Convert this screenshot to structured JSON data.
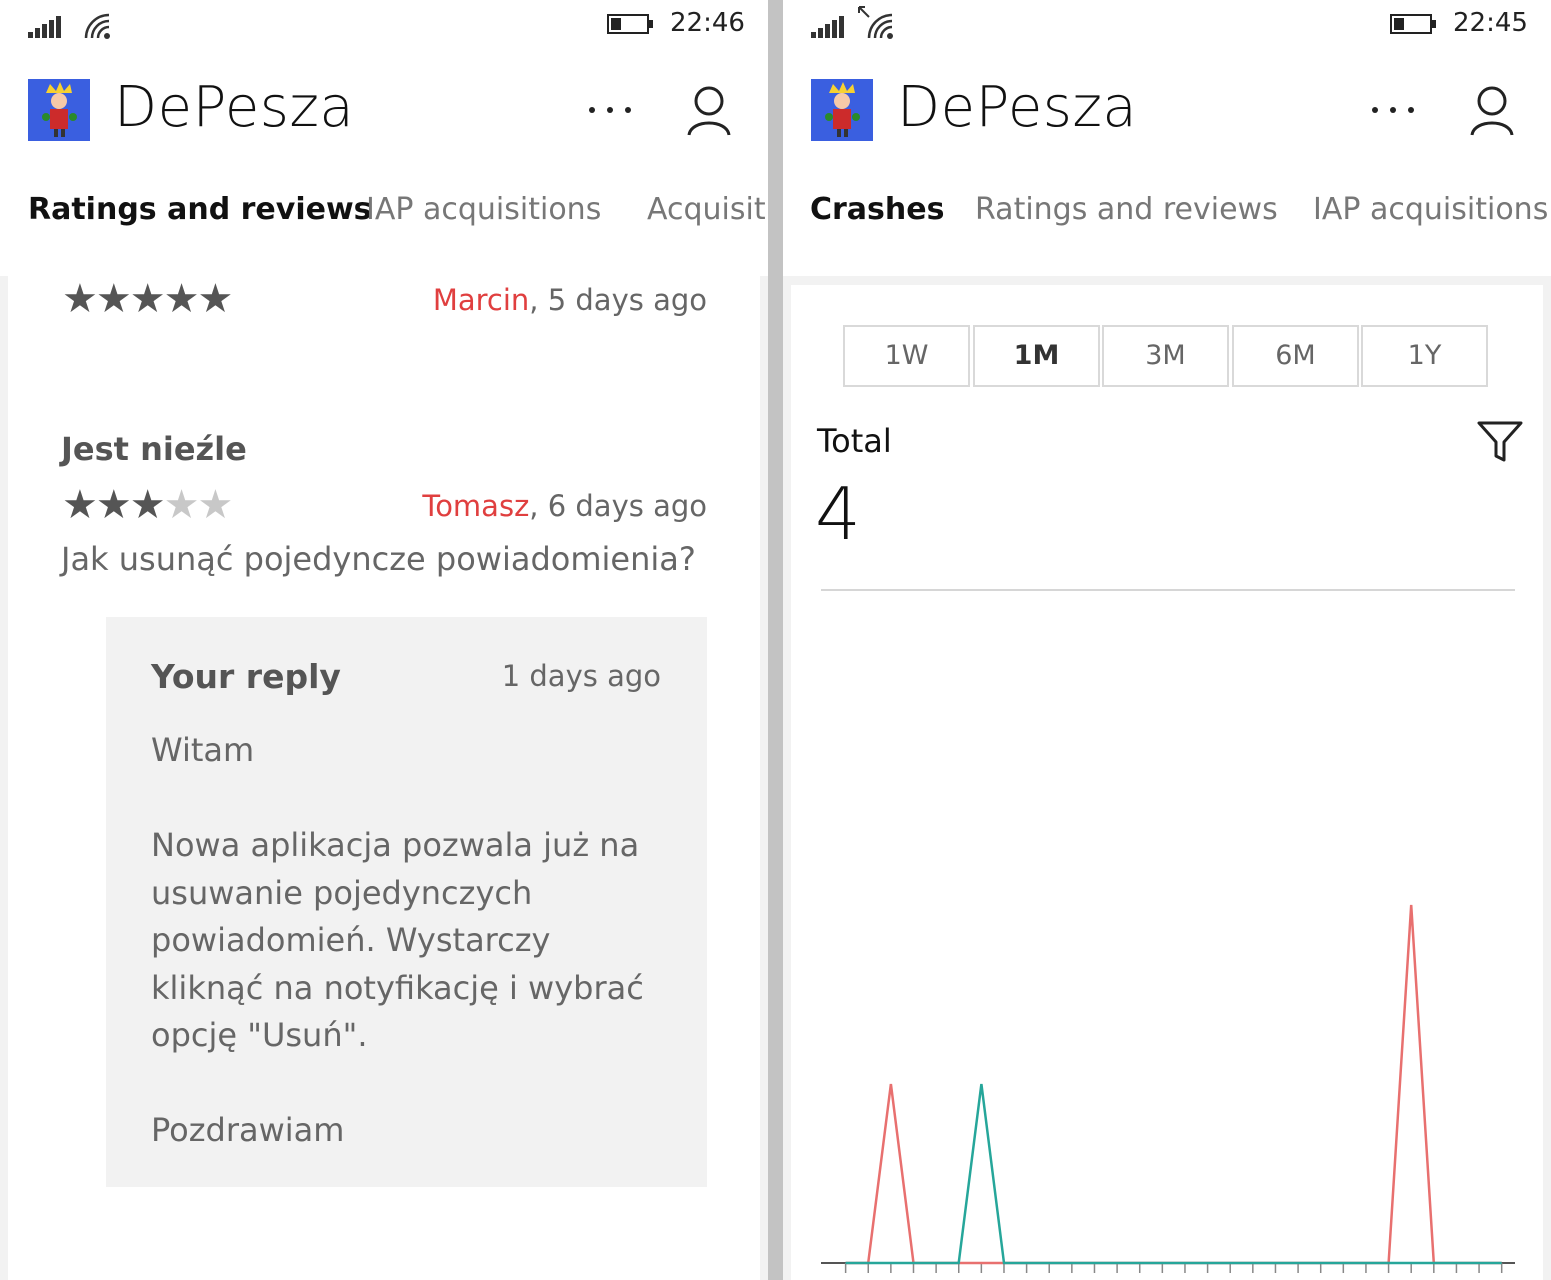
{
  "left_screen": {
    "status": {
      "time": "22:46"
    },
    "app_title": "DePesza",
    "tabs": [
      {
        "label": "Ratings and reviews",
        "active": true
      },
      {
        "label": "IAP acquisitions",
        "active": false
      },
      {
        "label": "Acquisiti",
        "active": false
      }
    ],
    "reviews": [
      {
        "rating": 5,
        "author": "Marcin",
        "age": ", 5 days ago"
      },
      {
        "title": "Jest nieźle",
        "rating": 3,
        "author": "Tomasz",
        "age": ", 6 days ago",
        "text": "Jak usunąć pojedyncze powiadomienia?",
        "reply": {
          "title": "Your reply",
          "age": "1 days ago",
          "greeting": "Witam",
          "body": "Nowa aplikacja pozwala już na usuwanie pojedynczych powiadomień. Wystarczy kliknąć na notyfikację i wybrać opcję \"Usuń\".",
          "closing": "Pozdrawiam"
        }
      }
    ]
  },
  "right_screen": {
    "status": {
      "time": "22:45"
    },
    "app_title": "DePesza",
    "tabs": [
      {
        "label": "Crashes",
        "active": true
      },
      {
        "label": "Ratings and reviews",
        "active": false
      },
      {
        "label": "IAP acquisitions",
        "active": false
      }
    ],
    "ranges": [
      {
        "label": "1W",
        "active": false
      },
      {
        "label": "1M",
        "active": true
      },
      {
        "label": "3M",
        "active": false
      },
      {
        "label": "6M",
        "active": false
      },
      {
        "label": "1Y",
        "active": false
      }
    ],
    "total_label": "Total",
    "total_value": "4"
  },
  "chart_data": {
    "type": "line",
    "title": "",
    "xlabel": "",
    "ylabel": "",
    "x": [
      1,
      2,
      3,
      4,
      5,
      6,
      7,
      8,
      9,
      10,
      11,
      12,
      13,
      14,
      15,
      16,
      17,
      18,
      19,
      20,
      21,
      22,
      23,
      24,
      25,
      26,
      27,
      28,
      29,
      30
    ],
    "ylim": [
      0,
      2
    ],
    "series": [
      {
        "color": "#e8706f",
        "values": [
          0,
          0,
          1,
          0,
          0,
          0,
          0,
          0,
          0,
          0,
          0,
          0,
          0,
          0,
          0,
          0,
          0,
          0,
          0,
          0,
          0,
          0,
          0,
          0,
          0,
          2,
          0,
          0,
          0,
          0
        ]
      },
      {
        "color": "#26a69a",
        "values": [
          0,
          0,
          0,
          0,
          0,
          0,
          1,
          0,
          0,
          0,
          0,
          0,
          0,
          0,
          0,
          0,
          0,
          0,
          0,
          0,
          0,
          0,
          0,
          0,
          0,
          0,
          0,
          0,
          0,
          0
        ]
      }
    ],
    "grid": false,
    "legend": "none"
  }
}
